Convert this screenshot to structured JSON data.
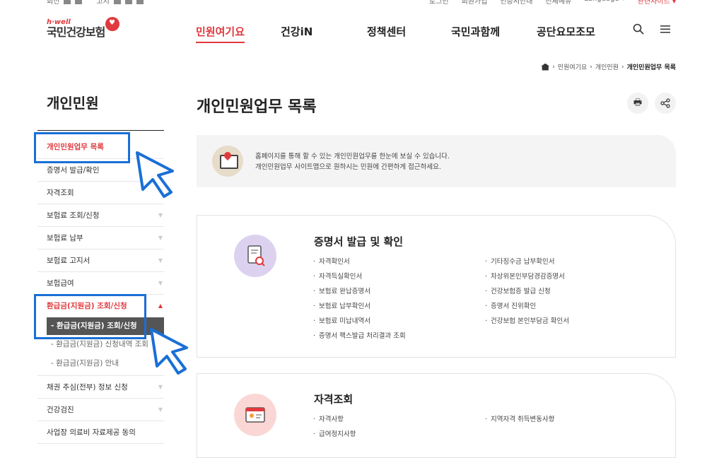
{
  "util": {
    "left": [
      "회신",
      "고지"
    ],
    "right": [
      "로그인",
      "회원가입",
      "인증서안내",
      "전체메뉴",
      "Language ▾",
      "관련사이트 ▾"
    ]
  },
  "logo": {
    "sub": "h·well",
    "main": "국민건강보험"
  },
  "gnb": [
    "민원여기요",
    "건강iN",
    "정책센터",
    "국민과함께",
    "공단요모조모"
  ],
  "icons": {
    "search": "search-icon",
    "menu": "menu-icon"
  },
  "breadcrumb": [
    "민원여기요",
    "개인민원",
    "개인민원업무 목록"
  ],
  "lnb": {
    "title": "개인민원",
    "items": [
      "개인민원업무 목록",
      "증명서 발급/확인",
      "자격조회",
      "보험료 조회/신청",
      "보험료 납부",
      "보험료 고지서",
      "보험급여",
      "환급금(지원금) 조회/신청"
    ],
    "subitems": [
      "환급금(지원금) 조회/신청",
      "환급금(지원금) 신청내역 조회",
      "환급금(지원금) 안내"
    ],
    "more": [
      "채권 추심(전부) 정보 신청",
      "건강검진",
      "사업장 의료비 자료제공 동의"
    ]
  },
  "page": {
    "title": "개인민원업무 목록",
    "info_line1": "홈페이지를 통해 할 수 있는 개인민원업무를 한눈에 보실 수 있습니다.",
    "info_line2": "개인민원업무 사이트맵으로 원하시는 민원에 간편하게 접근하세요."
  },
  "cards": [
    {
      "title": "증명서 발급 및 확인",
      "left": [
        "자격확인서",
        "자격득실확인서",
        "보험료 완납증명서",
        "보험료 납부확인서",
        "보험료 미납내역서",
        "증명서 팩스발급 처리결과 조회"
      ],
      "right": [
        "기타징수금 납부확인서",
        "차상위본인부담경감증명서",
        "건강보험증 발급 신청",
        "증명서 진위확인",
        "건강보험 본인부담금 확인서"
      ]
    },
    {
      "title": "자격조회",
      "left": [
        "자격사항",
        "급여정지사항"
      ],
      "right": [
        "지역자격 취득변동사항"
      ]
    }
  ],
  "colors": {
    "accent": "#e0393e",
    "highlight": "#1a6fd6"
  }
}
